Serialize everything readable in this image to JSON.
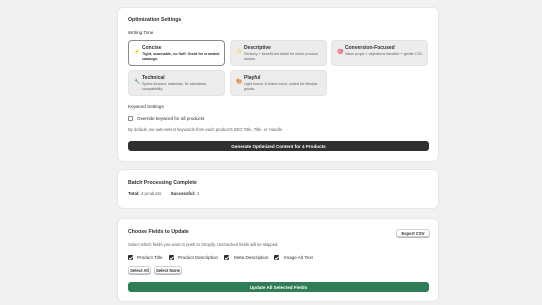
{
  "optimization": {
    "title": "Optimization Settings",
    "writing_tone_label": "Writing Tone",
    "tones": [
      {
        "name": "Concise",
        "icon": "⚡",
        "description": "Tight, scannable, no fluff. Great for crowded catalogs.",
        "selected": true
      },
      {
        "name": "Descriptive",
        "icon": "✨",
        "description": "Sensory + benefit-led detail for richer product stories.",
        "selected": false
      },
      {
        "name": "Conversion-Focused",
        "icon": "🎯",
        "description": "Value props + objections handled + gentle CTA.",
        "selected": false
      },
      {
        "name": "Technical",
        "icon": "🔧",
        "description": "Specs-forward, materials, fit, standards, compatibility.",
        "selected": false
      },
      {
        "name": "Playful",
        "icon": "🎨",
        "description": "Light humor & brand voice, suited for lifestyle goods.",
        "selected": false
      }
    ],
    "keyword_settings_label": "Keyword Settings",
    "override_label": "Override keyword for all products",
    "override_checked": false,
    "keyword_hint": "By default, we auto-select keywords from each product's SEO Title, Title, or Handle.",
    "generate_button": "Generate Optimized Content for 4 Products"
  },
  "batch": {
    "title": "Batch Processing Complete",
    "total_label": "Total:",
    "total_value": "4 products",
    "success_label": "Successful:",
    "success_value": "4"
  },
  "fields": {
    "title": "Choose Fields to Update",
    "export_button": "Export CSV",
    "hint": "Select which fields you want to push to Shopify. Unchecked fields will be skipped.",
    "options": [
      {
        "label": "Product Title",
        "checked": true
      },
      {
        "label": "Product Description",
        "checked": true
      },
      {
        "label": "Meta Description",
        "checked": true
      },
      {
        "label": "Image Alt Text",
        "checked": true
      }
    ],
    "select_all": "Select All",
    "select_none": "Select None",
    "update_button": "Update All Selected Fields"
  }
}
